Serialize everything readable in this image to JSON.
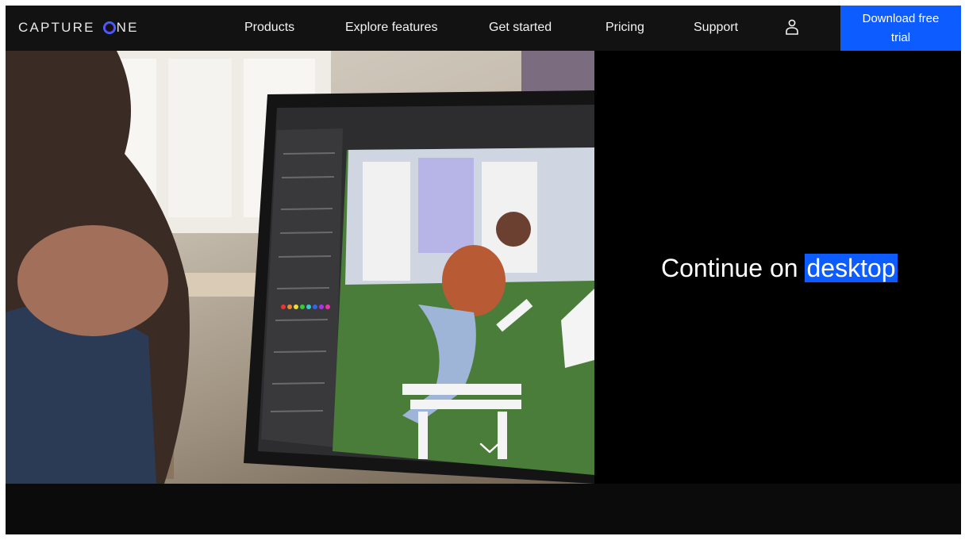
{
  "brand": {
    "logo_text_left": "CAPTURE",
    "logo_text_right": "NE"
  },
  "nav": {
    "items": [
      {
        "label": "Products"
      },
      {
        "label": "Explore features"
      },
      {
        "label": "Get started"
      },
      {
        "label": "Pricing"
      },
      {
        "label": "Support"
      }
    ],
    "user_icon": "user-icon",
    "cta_label": "Download free trial"
  },
  "hero": {
    "headline_pre": "Continue on",
    "headline_highlight": "desktop",
    "scroll_icon": "chevron-down-icon"
  },
  "colors": {
    "accent": "#0d5cff",
    "nav_bg": "#121212",
    "hero_bg": "#000000"
  }
}
